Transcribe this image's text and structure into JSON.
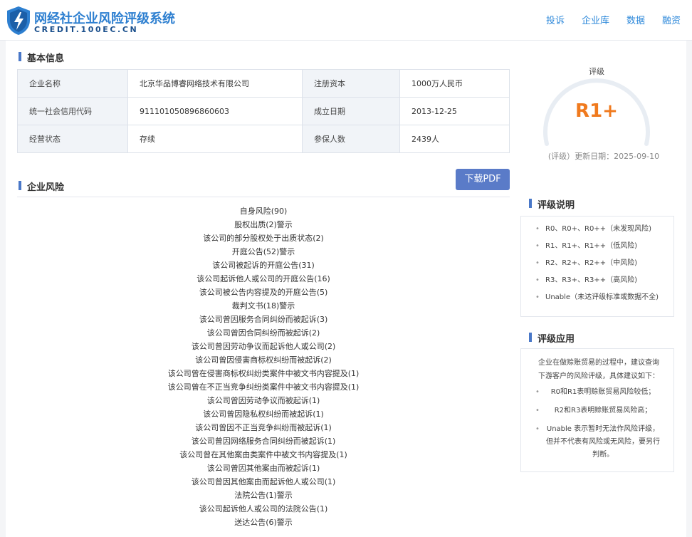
{
  "header": {
    "logo_title": "网经社企业风险评级系统",
    "logo_sub": "CREDIT.100EC.CN",
    "nav": [
      "投诉",
      "企业库",
      "数据",
      "融资"
    ]
  },
  "basic": {
    "title": "基本信息",
    "rows": [
      {
        "k1": "企业名称",
        "v1": "北京华品博睿网络技术有限公司",
        "k2": "注册资本",
        "v2": "1000万人民币"
      },
      {
        "k1": "统一社会信用代码",
        "v1": "911101050896860603",
        "k2": "成立日期",
        "v2": "2013-12-25"
      },
      {
        "k1": "经营状态",
        "v1": "存续",
        "k2": "参保人数",
        "v2": "2439人"
      }
    ]
  },
  "risk": {
    "title": "企业风险",
    "pdf_button": "下载PDF",
    "items": [
      "自身风险(90)",
      "股权出质(2)警示",
      "该公司的部分股权处于出质状态(2)",
      "开庭公告(52)警示",
      "该公司被起诉的开庭公告(31)",
      "该公司起诉他人或公司的开庭公告(16)",
      "该公司被公告内容提及的开庭公告(5)",
      "裁判文书(18)警示",
      "该公司曾因服务合同纠纷而被起诉(3)",
      "该公司曾因合同纠纷而被起诉(2)",
      "该公司曾因劳动争议而起诉他人或公司(2)",
      "该公司曾因侵害商标权纠纷而被起诉(2)",
      "该公司曾在侵害商标权纠纷类案件中被文书内容提及(1)",
      "该公司曾在不正当竞争纠纷类案件中被文书内容提及(1)",
      "该公司曾因劳动争议而被起诉(1)",
      "该公司曾因隐私权纠纷而被起诉(1)",
      "该公司曾因不正当竞争纠纷而被起诉(1)",
      "该公司曾因网络服务合同纠纷而被起诉(1)",
      "该公司曾在其他案由类案件中被文书内容提及(1)",
      "该公司曾因其他案由而被起诉(1)",
      "该公司曾因其他案由而起诉他人或公司(1)",
      "法院公告(1)警示",
      "该公司起诉他人或公司的法院公告(1)",
      "送达公告(6)警示"
    ]
  },
  "rating": {
    "label": "评级",
    "value": "R1+",
    "value_color": "#f07a1e",
    "date": "(评级）更新日期：2025-09-10"
  },
  "explain": {
    "title": "评级说明",
    "items": [
      "R0、R0+、R0++（未发现风险)",
      "R1、R1+、R1++（低风险)",
      "R2、R2+、R2++（中风险)",
      "R3、R3+、R3++（高风险)",
      "Unable（未达评级标准或数据不全)"
    ]
  },
  "application": {
    "title": "评级应用",
    "intro": "企业在做赊账贸易的过程中，建议查询下游客户的风险评级，具体建议如下：",
    "items": [
      "R0和R1表明赊账贸易风险较低；",
      "R2和R3表明赊账贸易风险高；",
      "Unable 表示暂时无法作风险评级，但并不代表有风险或无风险，要另行判断。"
    ]
  }
}
